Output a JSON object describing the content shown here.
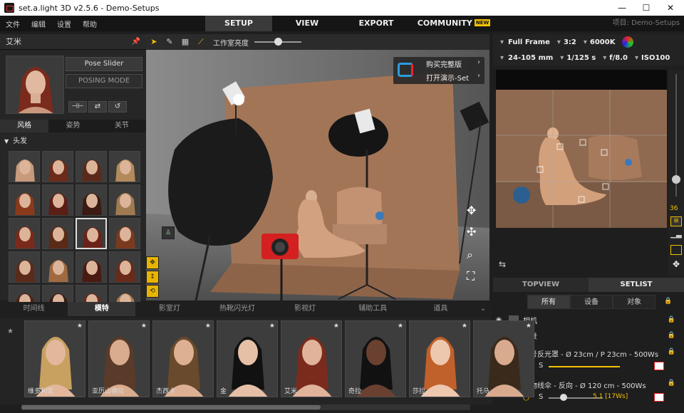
{
  "window": {
    "title": "set.a.light 3D v2.5.6 - Demo-Setups",
    "controls": [
      "—",
      "☐",
      "✕"
    ]
  },
  "menu": {
    "items": [
      "文件",
      "编辑",
      "设置",
      "帮助"
    ]
  },
  "main_tabs": [
    {
      "label": "SETUP",
      "active": true
    },
    {
      "label": "VIEW",
      "active": false
    },
    {
      "label": "EXPORT",
      "active": false
    },
    {
      "label": "COMMUNITY",
      "active": false,
      "badge": "NEW"
    }
  ],
  "project_label": "项目: Demo-Setups",
  "left_panel": {
    "title": "艾米",
    "pose_slider": "Pose Slider",
    "posing_mode": "POSING MODE",
    "tabs": [
      "风格",
      "姿势",
      "关节"
    ],
    "section": "头发",
    "hair_count": 20
  },
  "toolbar": {
    "brightness_label": "工作室亮度"
  },
  "viewport": {
    "buy_label": "购买完整版",
    "open_demo_label": "打开演示-Set"
  },
  "camera": {
    "sensor": "Full Frame",
    "ratio": "3:2",
    "temperature": "6000K",
    "lens": "24-105 mm",
    "shutter": "1/125 s",
    "aperture": "f/8.0",
    "iso": "ISO100",
    "focal_value": "36"
  },
  "right_tabs": [
    {
      "label": "TOPVIEW",
      "active": false
    },
    {
      "label": "SETLIST",
      "active": true
    }
  ],
  "set_filters": [
    {
      "label": "所有",
      "active": true
    },
    {
      "label": "设备",
      "active": false
    },
    {
      "label": "对象",
      "active": false
    }
  ],
  "setlist": [
    {
      "name": "相机"
    },
    {
      "name": "背景"
    },
    {
      "name": "大号反光罩 - Ø 23cm / P 23cm - 500Ws"
    },
    {
      "name": "抛物线伞 - 反向 - Ø 120 cm - 500Ws",
      "value": "5.1 [17Ws]"
    }
  ],
  "bottom_tabs": [
    {
      "label": "时间线",
      "active": false
    },
    {
      "label": "模特",
      "active": true
    },
    {
      "label": "影室灯",
      "active": false
    },
    {
      "label": "热靴闪光灯",
      "active": false
    },
    {
      "label": "影视灯",
      "active": false
    },
    {
      "label": "辅助工具",
      "active": false
    },
    {
      "label": "道具",
      "active": false
    }
  ],
  "models": [
    "维多利亚",
    "亚历山德拉",
    "杰西卡",
    "金",
    "艾米",
    "奇拉",
    "莎拉",
    "托马"
  ]
}
